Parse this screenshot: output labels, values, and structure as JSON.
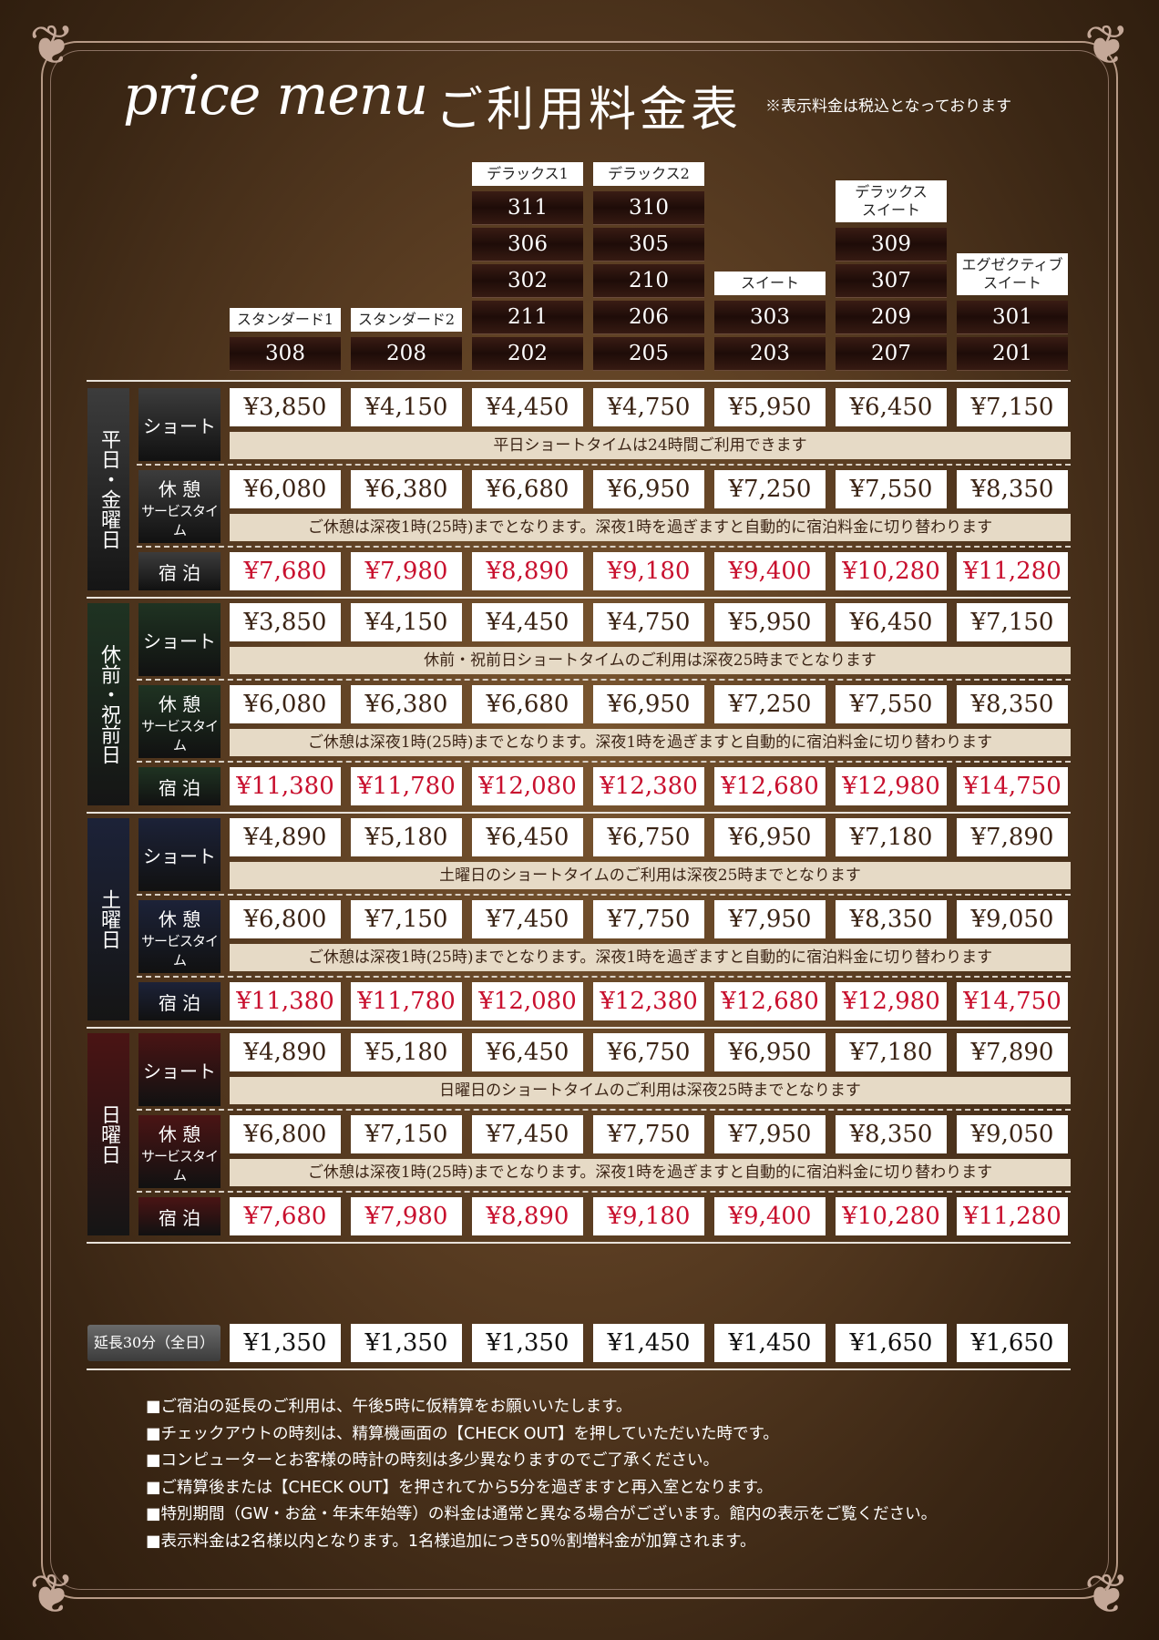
{
  "header": {
    "title_en": "price menu",
    "title_ja": "ご利用料金表",
    "tax_note": "※表示料金は税込となっております"
  },
  "columns": [
    {
      "label": "スタンダード1",
      "rooms": [
        "308"
      ]
    },
    {
      "label": "スタンダード2",
      "rooms": [
        "208"
      ]
    },
    {
      "label": "デラックス1",
      "rooms": [
        "311",
        "306",
        "302",
        "211",
        "202"
      ]
    },
    {
      "label": "デラックス2",
      "rooms": [
        "310",
        "305",
        "210",
        "206",
        "205"
      ]
    },
    {
      "label": "スイート",
      "rooms": [
        "303",
        "203"
      ]
    },
    {
      "label": "デラックス\nスイート",
      "rooms": [
        "309",
        "307",
        "209",
        "207"
      ]
    },
    {
      "label": "エグゼクティブ\nスイート",
      "rooms": [
        "301",
        "201"
      ]
    }
  ],
  "sections": [
    {
      "day": "平日・金曜日",
      "color": "#3c3c3c",
      "rows": [
        {
          "type": "ショート",
          "sub": "",
          "prices": [
            "¥3,850",
            "¥4,150",
            "¥4,450",
            "¥4,750",
            "¥5,950",
            "¥6,450",
            "¥7,150"
          ],
          "style": "brown",
          "note": "平日ショートタイムは24時間ご利用できます"
        },
        {
          "type": "休 憩",
          "sub": "サービスタイム",
          "prices": [
            "¥6,080",
            "¥6,380",
            "¥6,680",
            "¥6,950",
            "¥7,250",
            "¥7,550",
            "¥8,350"
          ],
          "style": "brown",
          "note": "ご休憩は深夜1時(25時)までとなります。深夜1時を過ぎますと自動的に宿泊料金に切り替わります"
        },
        {
          "type": "宿 泊",
          "sub": "",
          "prices": [
            "¥7,680",
            "¥7,980",
            "¥8,890",
            "¥9,180",
            "¥9,400",
            "¥10,280",
            "¥11,280"
          ],
          "style": "red",
          "note": ""
        }
      ]
    },
    {
      "day": "休前・祝前日",
      "color": "#1f3322",
      "rows": [
        {
          "type": "ショート",
          "sub": "",
          "prices": [
            "¥3,850",
            "¥4,150",
            "¥4,450",
            "¥4,750",
            "¥5,950",
            "¥6,450",
            "¥7,150"
          ],
          "style": "brown",
          "note": "休前・祝前日ショートタイムのご利用は深夜25時までとなります"
        },
        {
          "type": "休 憩",
          "sub": "サービスタイム",
          "prices": [
            "¥6,080",
            "¥6,380",
            "¥6,680",
            "¥6,950",
            "¥7,250",
            "¥7,550",
            "¥8,350"
          ],
          "style": "brown",
          "note": "ご休憩は深夜1時(25時)までとなります。深夜1時を過ぎますと自動的に宿泊料金に切り替わります"
        },
        {
          "type": "宿 泊",
          "sub": "",
          "prices": [
            "¥11,380",
            "¥11,780",
            "¥12,080",
            "¥12,380",
            "¥12,680",
            "¥12,980",
            "¥14,750"
          ],
          "style": "red",
          "note": ""
        }
      ]
    },
    {
      "day": "土曜日",
      "color": "#1c2238",
      "rows": [
        {
          "type": "ショート",
          "sub": "",
          "prices": [
            "¥4,890",
            "¥5,180",
            "¥6,450",
            "¥6,750",
            "¥6,950",
            "¥7,180",
            "¥7,890"
          ],
          "style": "brown",
          "note": "土曜日のショートタイムのご利用は深夜25時までとなります"
        },
        {
          "type": "休 憩",
          "sub": "サービスタイム",
          "prices": [
            "¥6,800",
            "¥7,150",
            "¥7,450",
            "¥7,750",
            "¥7,950",
            "¥8,350",
            "¥9,050"
          ],
          "style": "brown",
          "note": "ご休憩は深夜1時(25時)までとなります。深夜1時を過ぎますと自動的に宿泊料金に切り替わります"
        },
        {
          "type": "宿 泊",
          "sub": "",
          "prices": [
            "¥11,380",
            "¥11,780",
            "¥12,080",
            "¥12,380",
            "¥12,680",
            "¥12,980",
            "¥14,750"
          ],
          "style": "red",
          "note": ""
        }
      ]
    },
    {
      "day": "日曜日",
      "color": "#4a1414",
      "rows": [
        {
          "type": "ショート",
          "sub": "",
          "prices": [
            "¥4,890",
            "¥5,180",
            "¥6,450",
            "¥6,750",
            "¥6,950",
            "¥7,180",
            "¥7,890"
          ],
          "style": "brown",
          "note": "日曜日のショートタイムのご利用は深夜25時までとなります"
        },
        {
          "type": "休 憩",
          "sub": "サービスタイム",
          "prices": [
            "¥6,800",
            "¥7,150",
            "¥7,450",
            "¥7,750",
            "¥7,950",
            "¥8,350",
            "¥9,050"
          ],
          "style": "brown",
          "note": "ご休憩は深夜1時(25時)までとなります。深夜1時を過ぎますと自動的に宿泊料金に切り替わります"
        },
        {
          "type": "宿 泊",
          "sub": "",
          "prices": [
            "¥7,680",
            "¥7,980",
            "¥8,890",
            "¥9,180",
            "¥9,400",
            "¥10,280",
            "¥11,280"
          ],
          "style": "red",
          "note": ""
        }
      ]
    }
  ],
  "extension": {
    "label": "延長30分（全日）",
    "prices": [
      "¥1,350",
      "¥1,350",
      "¥1,350",
      "¥1,450",
      "¥1,450",
      "¥1,650",
      "¥1,650"
    ]
  },
  "notes": [
    "■ご宿泊の延長のご利用は、午後5時に仮精算をお願いいたします。",
    "■チェックアウトの時刻は、精算機画面の【CHECK OUT】を押していただいた時です。",
    "■コンピューターとお客様の時計の時刻は多少異なりますのでご了承ください。",
    "■ご精算後または【CHECK OUT】を押されてから5分を過ぎますと再入室となります。",
    "■特別期間（GW・お盆・年末年始等）の料金は通常と異なる場合がございます。館内の表示をご覧ください。",
    "■表示料金は2名様以内となります。1名様追加につき50％割増料金が加算されます。"
  ]
}
